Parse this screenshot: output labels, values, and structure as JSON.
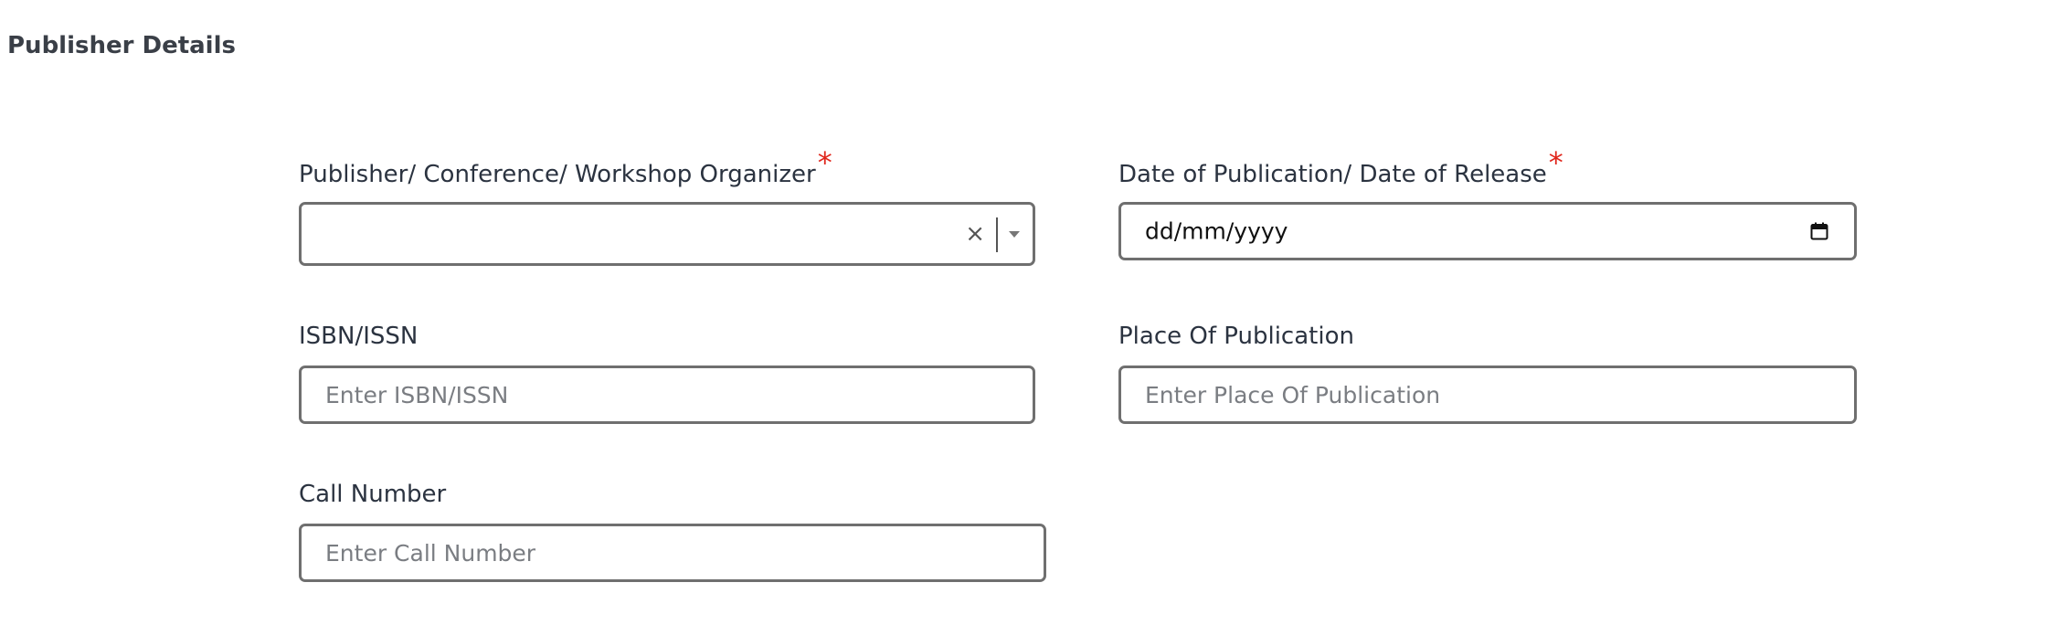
{
  "section": {
    "title": "Publisher Details"
  },
  "fields": {
    "publisher": {
      "label": "Publisher/ Conference/ Workshop Organizer",
      "required_mark": "*",
      "value": "",
      "clear_glyph": "×"
    },
    "date": {
      "label": "Date of Publication/ Date of Release",
      "required_mark": "*",
      "value_display": "dd/mm/yyyy"
    },
    "isbn": {
      "label": "ISBN/ISSN",
      "value": "",
      "placeholder": "Enter ISBN/ISSN"
    },
    "place": {
      "label": "Place Of Publication",
      "value": "",
      "placeholder": "Enter Place Of Publication"
    },
    "call_number": {
      "label": "Call Number",
      "value": "",
      "placeholder": "Enter Call Number"
    }
  },
  "icons": {
    "calendar": "calendar-icon",
    "dropdown": "chevron-down-icon",
    "clear": "close-icon"
  },
  "colors": {
    "required": "#e0261c",
    "border": "#6f6f6f",
    "label": "#2b3340",
    "placeholder": "#7a7d82"
  }
}
